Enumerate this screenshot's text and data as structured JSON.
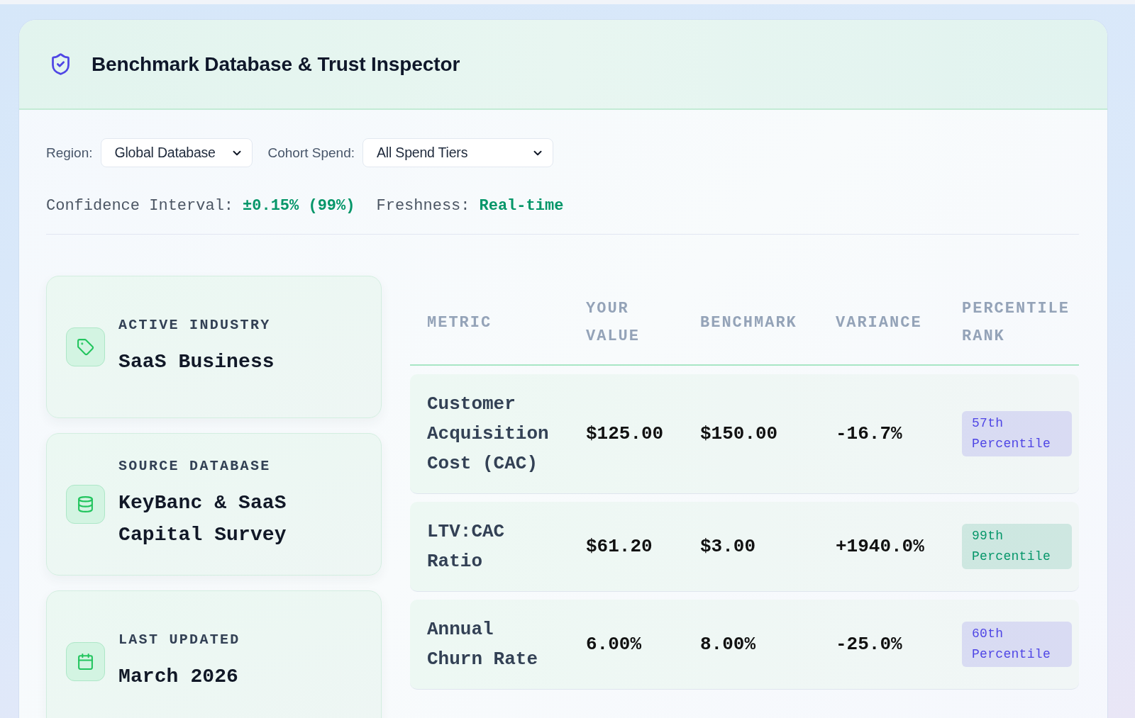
{
  "header": {
    "title": "Benchmark Database & Trust Inspector"
  },
  "filters": [
    {
      "label": "Region:",
      "value": "Global Database"
    },
    {
      "label": "Cohort Spend:",
      "value": "All Spend Tiers"
    }
  ],
  "stats": [
    {
      "label": "Confidence Interval:",
      "value": "±0.15% (99%)"
    },
    {
      "label": "Freshness:",
      "value": "Real-time"
    }
  ],
  "info_cards": [
    {
      "kind": "industry",
      "label": "ACTIVE INDUSTRY",
      "value": "SaaS Business"
    },
    {
      "kind": "source",
      "label": "SOURCE DATABASE",
      "value": "KeyBanc & SaaS Capital Survey"
    },
    {
      "kind": "updated",
      "label": "LAST UPDATED",
      "value": "March 2026"
    }
  ],
  "table": {
    "columns": [
      "METRIC",
      "YOUR VALUE",
      "BENCHMARK",
      "VARIANCE",
      "PERCENTILE RANK"
    ],
    "rows": [
      {
        "metric": "Customer Acquisition Cost (CAC)",
        "your_value": "$125.00",
        "benchmark": "$150.00",
        "variance": "-16.7%",
        "rank": {
          "label": "57th Percentile",
          "color": "#4f46e5"
        }
      },
      {
        "metric": "LTV:CAC Ratio",
        "your_value": "$61.20",
        "benchmark": "$3.00",
        "variance": "+1940.0%",
        "rank": {
          "label": "99th Percentile",
          "color": "#059669"
        }
      },
      {
        "metric": "Annual Churn Rate",
        "your_value": "6.00%",
        "benchmark": "8.00%",
        "variance": "-25.0%",
        "rank": {
          "label": "60th Percentile",
          "color": "#4f46e5"
        }
      }
    ]
  }
}
